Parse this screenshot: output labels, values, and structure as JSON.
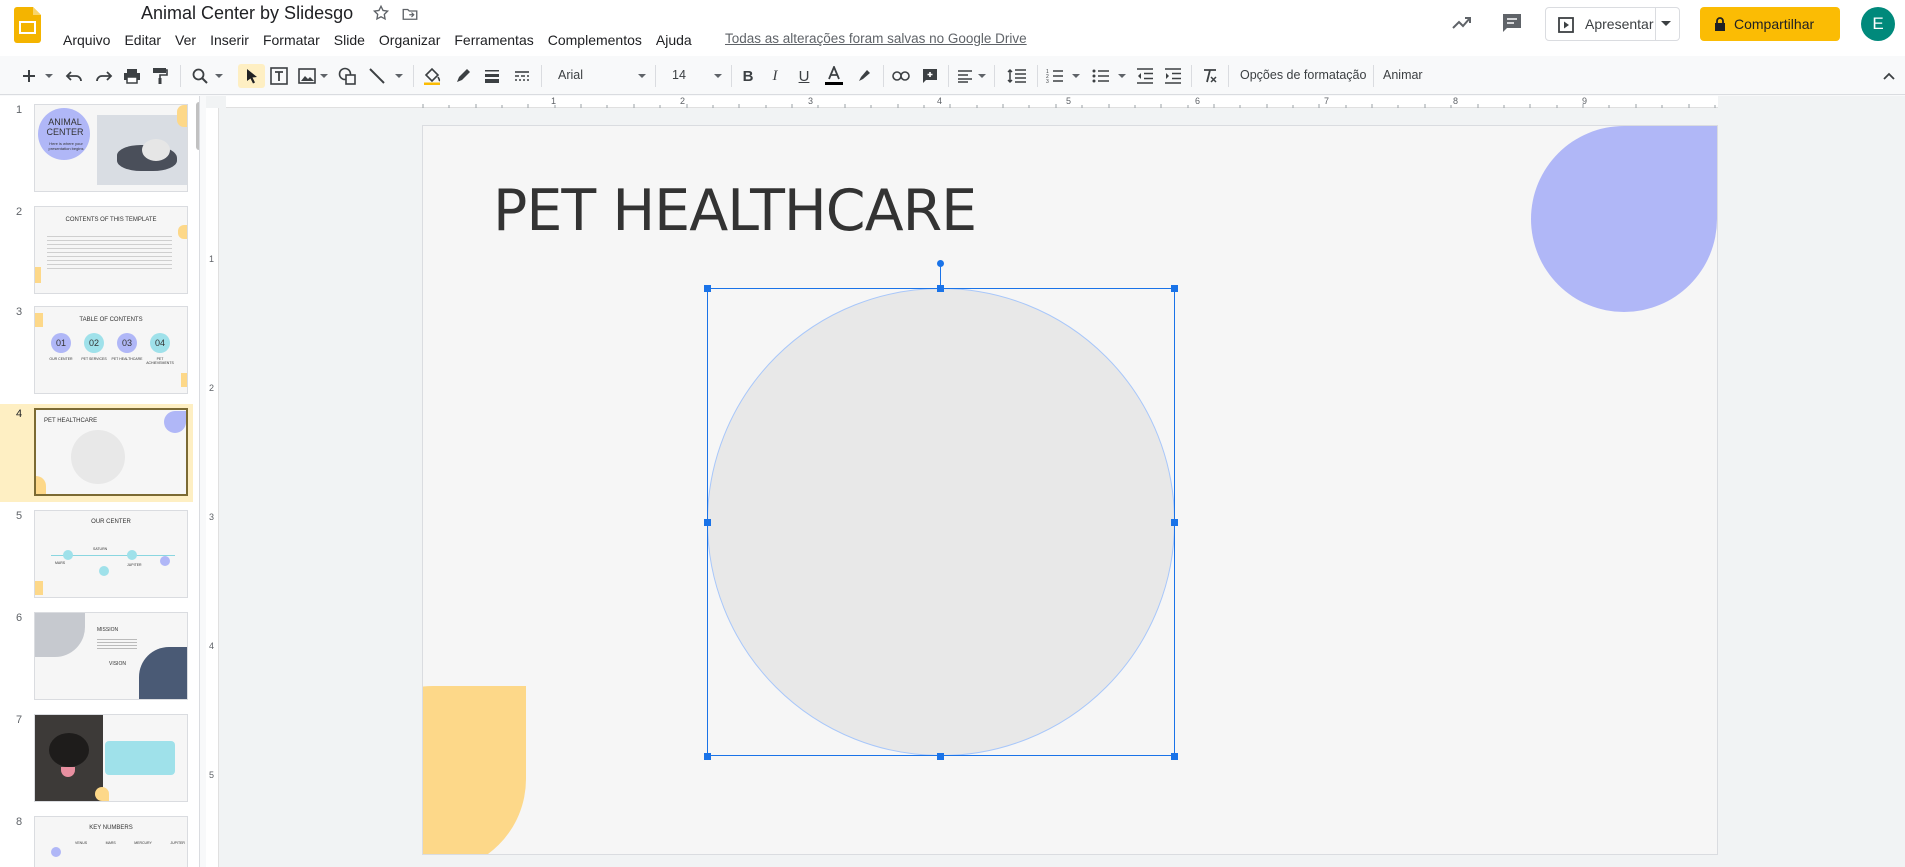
{
  "app": {
    "title": "Animal Center by Slidesgo",
    "saved_status": "Todas as alterações foram salvas no Google Drive",
    "menu": [
      "Arquivo",
      "Editar",
      "Ver",
      "Inserir",
      "Formatar",
      "Slide",
      "Organizar",
      "Ferramentas",
      "Complementos",
      "Ajuda"
    ],
    "present_label": "Apresentar",
    "share_label": "Compartilhar",
    "avatar_letter": "E",
    "brand_colors": {
      "share": "#fbbc04",
      "avatar": "#00897b",
      "selection": "#1a73e8"
    }
  },
  "toolbar": {
    "font": "Arial",
    "font_size": "14",
    "format_options": "Opções de formatação",
    "animate": "Animar"
  },
  "rulers": {
    "horizontal": [
      "1",
      "2",
      "3",
      "4",
      "5",
      "6",
      "7",
      "8",
      "9"
    ],
    "vertical": [
      "1",
      "2",
      "3",
      "4",
      "5"
    ]
  },
  "slides": [
    {
      "num": "1",
      "title": "ANIMAL CENTER",
      "subtitle": "Here is where your presentation begins"
    },
    {
      "num": "2",
      "title": "CONTENTS OF THIS TEMPLATE"
    },
    {
      "num": "3",
      "title": "TABLE OF CONTENTS",
      "items": [
        "01",
        "02",
        "03",
        "04"
      ],
      "labels": [
        "OUR CENTER",
        "PET SERVICES",
        "PET HEALTHCARE",
        "PET ACHIEVEMENTS"
      ]
    },
    {
      "num": "4",
      "title": "PET HEALTHCARE"
    },
    {
      "num": "5",
      "title": "OUR CENTER",
      "items": [
        "MARS",
        "SATURN",
        "JUPITER"
      ]
    },
    {
      "num": "6",
      "title": "MISSION",
      "subtitle": "VISION"
    },
    {
      "num": "7",
      "title": ""
    },
    {
      "num": "8",
      "title": "KEY NUMBERS",
      "items": [
        "VENUS",
        "MARS",
        "MERCURY",
        "JUPITER"
      ]
    }
  ],
  "main_slide": {
    "title": "PET HEALTHCARE"
  }
}
